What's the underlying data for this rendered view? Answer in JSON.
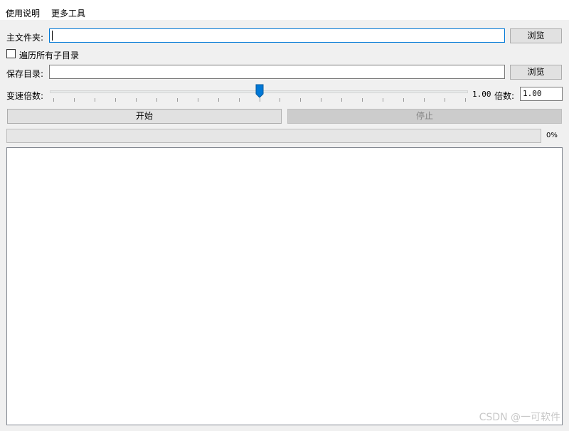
{
  "menu": {
    "items": [
      "使用说明",
      "更多工具"
    ]
  },
  "main_folder": {
    "label": "主文件夹:",
    "value": "",
    "browse_label": "浏览"
  },
  "recurse": {
    "label": "遍历所有子目录",
    "checked": false
  },
  "save_dir": {
    "label": "保存目录:",
    "value": "",
    "browse_label": "浏览"
  },
  "speed": {
    "label": "变速倍数:",
    "slider_value": 1.0,
    "display": "1.00",
    "multiplier_label": "倍数:",
    "input_value": "1.00"
  },
  "actions": {
    "start_label": "开始",
    "stop_label": "停止",
    "stop_enabled": false
  },
  "progress": {
    "value": 0,
    "text": "0%"
  },
  "log": {
    "content": ""
  },
  "watermark": "CSDN @一可软件",
  "colors": {
    "focus_border": "#0078d7",
    "slider_thumb": "#0078d7",
    "progress_fill": "#06b025"
  }
}
